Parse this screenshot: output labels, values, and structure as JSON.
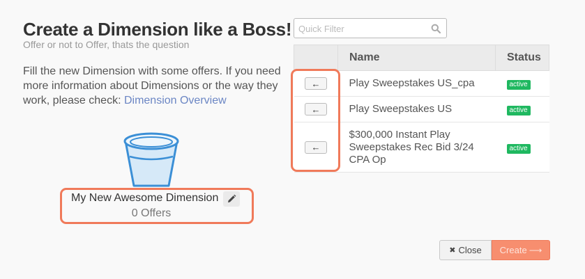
{
  "header": {
    "title": "Create a Dimension like a Boss!",
    "subtitle": "Offer or not to Offer, thats the question"
  },
  "info": {
    "text": "Fill the new Dimension with some offers. If you need more information about Dimensions or the way they work, please check: ",
    "link_label": "Dimension Overview"
  },
  "dimension": {
    "name": "My New Awesome Dimension",
    "count_label": "0 Offers"
  },
  "filter": {
    "placeholder": "Quick Filter",
    "icon": "search-icon"
  },
  "table": {
    "headers": {
      "action": "",
      "name": "Name",
      "status": "Status"
    },
    "rows": [
      {
        "action": "←",
        "name": "Play Sweepstakes US_cpa",
        "status": "active"
      },
      {
        "action": "←",
        "name": "Play Sweepstakes US",
        "status": "active"
      },
      {
        "action": "←",
        "name": "$300,000 Instant Play Sweepstakes Rec Bid 3/24 CPA Op",
        "status": "active"
      }
    ]
  },
  "footer": {
    "close_label": "Close",
    "close_icon": "✖",
    "create_label": "Create",
    "create_icon": "⟶"
  },
  "colors": {
    "highlight": "#f07a5a",
    "badge_active": "#1fb860",
    "link": "#6b86c4",
    "primary_button": "#f78e6f",
    "bucket_stroke": "#3b8fd6",
    "bucket_fill": "#d6e9f8"
  }
}
